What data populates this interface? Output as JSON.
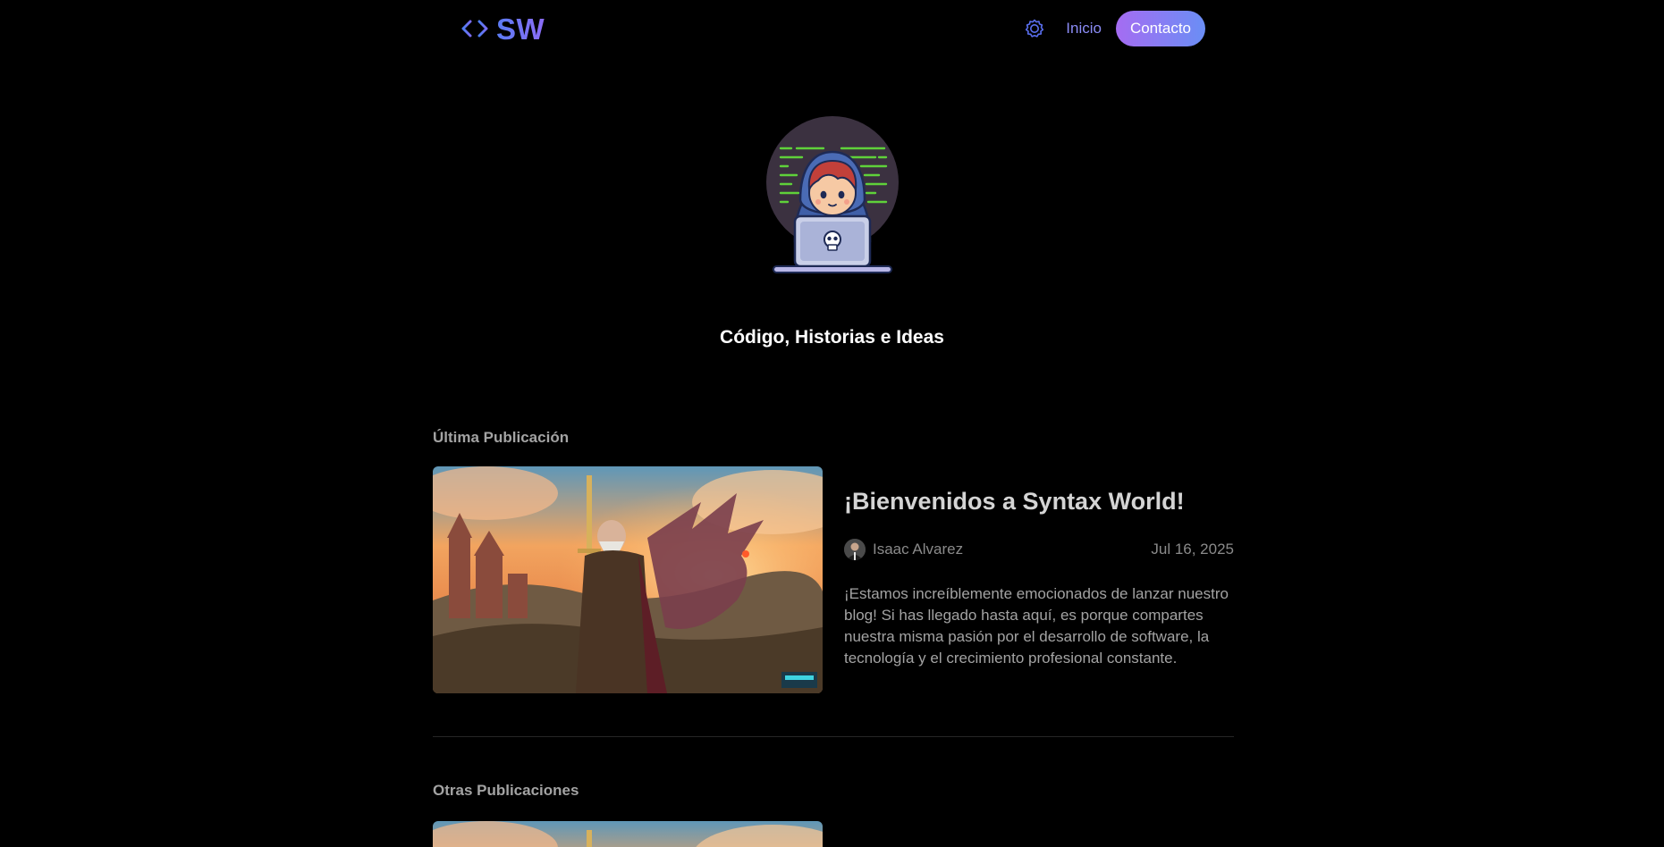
{
  "header": {
    "logo_text": "SW",
    "nav": {
      "home_label": "Inicio",
      "contact_label": "Contacto"
    },
    "icons": {
      "logo": "code-brackets-icon",
      "theme_toggle": "sun-gear-icon"
    }
  },
  "hero": {
    "avatar": "hacker-with-laptop-illustration",
    "subtitle": "Código, Historias e Ideas"
  },
  "latest": {
    "section_label": "Última Publicación",
    "post": {
      "title": "¡Bienvenidos a Syntax World!",
      "author": "Isaac Alvarez",
      "date": "Jul 16, 2025",
      "excerpt": "¡Estamos increíblemente emocionados de lanzar nuestro blog! Si has llegado hasta aquí, es porque compartes nuestra misma pasión por el desarrollo de software, la tecnología y el crecimiento profesional constante.",
      "image": "warrior-and-dragon-fantasy-cover"
    }
  },
  "others": {
    "section_label": "Otras Publicaciones"
  },
  "colors": {
    "background": "#000000",
    "accent_blue": "#5b7cf4",
    "accent_purple": "#a56cf2",
    "nav_link": "#8b8cf6",
    "muted_text": "#a3a3a3"
  }
}
